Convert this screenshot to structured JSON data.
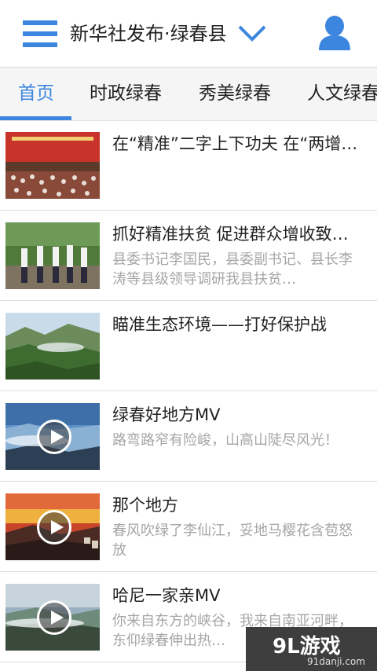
{
  "header": {
    "title": "新华社发布·绿春县"
  },
  "tabs": [
    {
      "label": "首页",
      "active": true
    },
    {
      "label": "时政绿春"
    },
    {
      "label": "秀美绿春"
    },
    {
      "label": "人文绿春"
    }
  ],
  "articles": [
    {
      "title": "在“精准”二字上下功夫 在“两增…",
      "desc": "",
      "video": false
    },
    {
      "title": "抓好精准扶贫 促进群众增收致…",
      "desc": "县委书记李国民，县委副书记、县长李涛等县级领导调研我县扶贫…",
      "video": false
    },
    {
      "title": "瞄准生态环境——打好保护战",
      "desc": "",
      "video": false
    },
    {
      "title": "绿春好地方MV",
      "desc": "路弯路窄有险峻，山高山陡尽风光！",
      "video": true
    },
    {
      "title": "那个地方",
      "desc": "春风吹绿了李仙江，妥地马樱花含苞怒放",
      "video": true
    },
    {
      "title": "哈尼一家亲MV",
      "desc": "你来自东方的峡谷，我来自南亚河畔，东仰绿春伸出热…",
      "video": true
    }
  ],
  "watermark": {
    "logo": "9L游戏",
    "url": "91danji.com"
  },
  "colors": {
    "accent": "#3d86e0",
    "text": "#222222",
    "muted": "#a6a6a6"
  },
  "icons": [
    "menu-icon",
    "chevron-down-icon",
    "user-icon",
    "play-icon"
  ]
}
